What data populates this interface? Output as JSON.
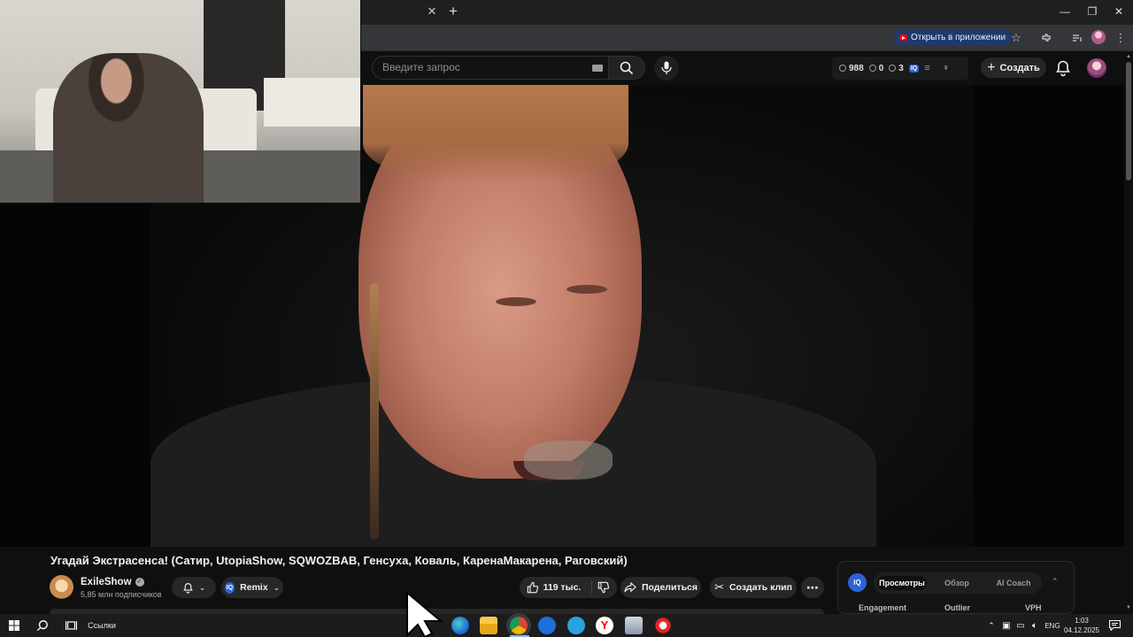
{
  "browser": {
    "tab_close": "✕",
    "new_tab": "+",
    "open_in_app": "Открыть в приложении",
    "window_controls": {
      "minimize": "—",
      "restore": "❐",
      "close": "✕"
    }
  },
  "youtube": {
    "search": {
      "placeholder": "Введите запрос"
    },
    "stats": {
      "views": "988",
      "likes": "0",
      "comments": "3",
      "iq": "IQ"
    },
    "create_label": "Создать"
  },
  "video": {
    "title": "Угадай Экстрасенса! (Сатир, UtopiaShow, SQWOZBAB, Генсуха, Коваль, КаренаМакарена, Раговский)",
    "channel": {
      "name": "ExileShow",
      "subscribers": "5,85 млн подписчиков"
    },
    "remix_label": "Remix",
    "likes": "119 тыс.",
    "share_label": "Поделиться",
    "clip_label": "Создать клип",
    "more": "⋯"
  },
  "side_panel": {
    "iq": "IQ",
    "tabs": [
      {
        "label": "Просмотры",
        "active": true
      },
      {
        "label": "Обзор",
        "active": false
      },
      {
        "label": "AI Coach",
        "active": false
      }
    ],
    "columns": [
      "Engagement",
      "Outlier",
      "VPH"
    ]
  },
  "taskbar": {
    "links_label": "Ссылки",
    "language": "ENG",
    "time": "1:03",
    "date": "04.12.2025",
    "apps": [
      "edge-icon",
      "file-explorer-icon",
      "chrome-icon",
      "tasks-icon",
      "telegram-icon",
      "yandex-browser-icon",
      "app-icon",
      "app-icon-2"
    ]
  },
  "colors": {
    "background": "#0f0f0f",
    "accent_red": "#ff0000",
    "iq_blue": "#2e63d6",
    "pill_bg": "#272727"
  }
}
